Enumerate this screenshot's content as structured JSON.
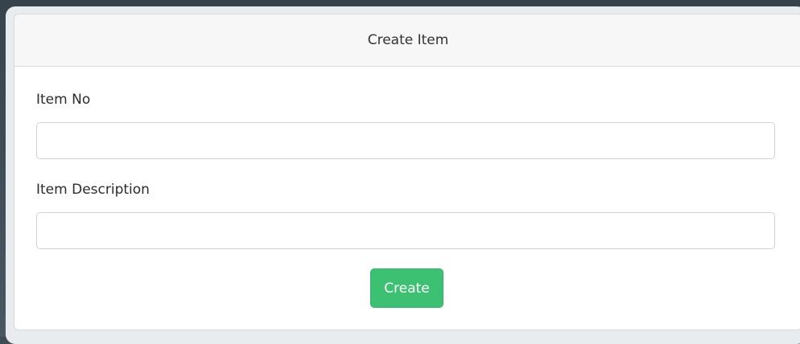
{
  "card": {
    "title": "Create Item"
  },
  "form": {
    "item_no": {
      "label": "Item No",
      "value": "",
      "placeholder": ""
    },
    "item_description": {
      "label": "Item Description",
      "value": "",
      "placeholder": ""
    },
    "submit_label": "Create"
  },
  "colors": {
    "accent": "#3cc072",
    "header_bg": "#f7f7f7",
    "backdrop": "#3f4b55"
  }
}
